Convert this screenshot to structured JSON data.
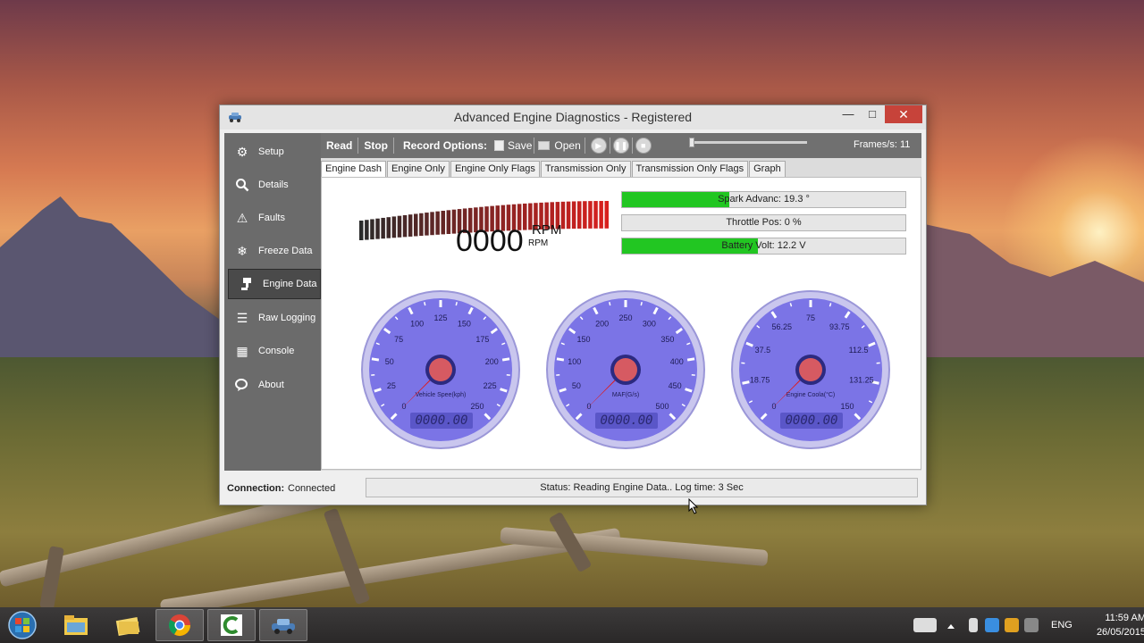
{
  "window": {
    "title": "Advanced Engine Diagnostics - Registered",
    "minimize": "—",
    "maximize": "□",
    "close": "✕"
  },
  "sidebar": {
    "items": [
      {
        "label": "Setup",
        "icon": "gears-icon",
        "glyph": "⚙"
      },
      {
        "label": "Details",
        "icon": "magnifier-icon",
        "glyph": "🔍"
      },
      {
        "label": "Faults",
        "icon": "warning-icon",
        "glyph": "⚠"
      },
      {
        "label": "Freeze Data",
        "icon": "snowflake-icon",
        "glyph": "❄"
      },
      {
        "label": "Engine Data",
        "icon": "piston-icon",
        "glyph": "⚙",
        "active": true
      },
      {
        "label": "Raw Logging",
        "icon": "lines-icon",
        "glyph": "☰"
      },
      {
        "label": "Console",
        "icon": "chip-icon",
        "glyph": "▦"
      },
      {
        "label": "About",
        "icon": "chat-icon",
        "glyph": "💬"
      }
    ]
  },
  "toolbar": {
    "read": "Read",
    "stop": "Stop",
    "record_options": "Record Options:",
    "save": "Save",
    "open": "Open",
    "frames": "Frames/s: 11"
  },
  "tabs": [
    "Engine Dash",
    "Engine Only",
    "Engine Only Flags",
    "Transmission Only",
    "Transmission Only Flags",
    "Graph"
  ],
  "active_tab": "Engine Dash",
  "rpm": {
    "value": "0000",
    "unit_large": "RPM",
    "unit_small": "RPM",
    "colors": {
      "start": "#2a2a2a",
      "end": "#d8201e"
    }
  },
  "bars": [
    {
      "label": "Spark Advanc: 19.3 °",
      "fill": 0.38
    },
    {
      "label": "Throttle Pos: 0 %",
      "fill": 0
    },
    {
      "label": "Battery Volt: 12.2 V",
      "fill": 0.48
    }
  ],
  "gauges": [
    {
      "name": "Vehicle Spee(kph)",
      "ticks": [
        "0",
        "25",
        "50",
        "75",
        "100",
        "125",
        "150",
        "175",
        "200",
        "225",
        "250"
      ],
      "readout": "0000.00"
    },
    {
      "name": "MAF(G/s)",
      "ticks": [
        "0",
        "50",
        "100",
        "150",
        "200",
        "250",
        "300",
        "350",
        "400",
        "450",
        "500"
      ],
      "readout": "0000.00"
    },
    {
      "name": "Engine Coola(°C)",
      "ticks": [
        "0",
        "18.75",
        "37.5",
        "56.25",
        "75",
        "93.75",
        "112.5",
        "131.25",
        "150"
      ],
      "readout": "0000.00"
    }
  ],
  "status": {
    "connection_label": "Connection:",
    "connection_value": "Connected",
    "message": "Status: Reading Engine Data..  Log time: 3 Sec"
  },
  "taskbar": {
    "apps": [
      "file-explorer-icon",
      "folder-icon",
      "chrome-icon",
      "camtasia-icon",
      "engine-diagnostics-icon"
    ],
    "language": "ENG",
    "time": "11:59 AM",
    "date": "26/05/2015"
  },
  "colors": {
    "gauge_face": "#7b74e6",
    "gauge_needle": "#e01818",
    "bar_fill": "#22c622",
    "close_button": "#c7433a"
  }
}
